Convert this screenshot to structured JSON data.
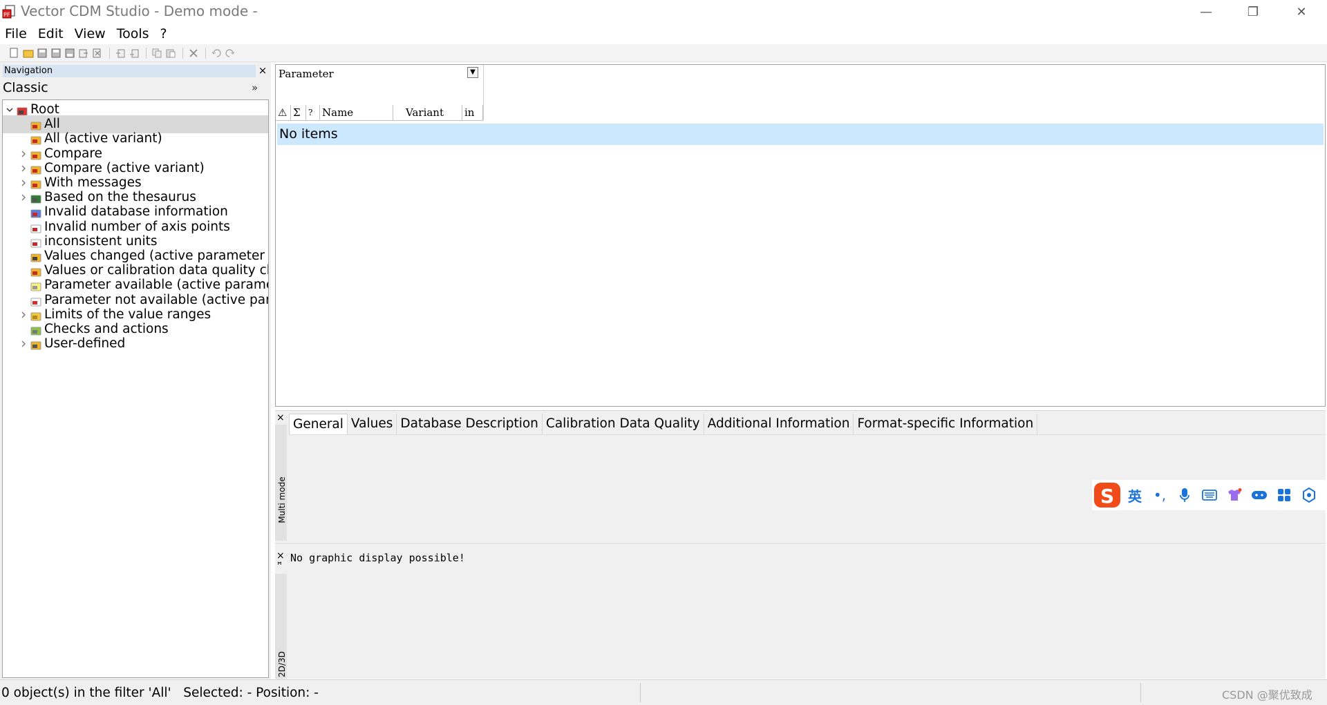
{
  "window": {
    "title": "Vector CDM Studio - Demo mode -",
    "controls": {
      "minimize": "—",
      "restore": "❐",
      "close": "✕"
    }
  },
  "menu": [
    "File",
    "Edit",
    "View",
    "Tools",
    "?"
  ],
  "toolbar": {
    "icons": [
      "new-file-icon",
      "open-folder-icon",
      "save-icon",
      "save-all-icon",
      "save-as-icon",
      "export-icon",
      "close-file-icon",
      "import-icon",
      "merge-icon",
      "copy-icon",
      "paste-icon",
      "delete-icon",
      "undo-icon",
      "redo-icon"
    ]
  },
  "navigation": {
    "header": "Navigation",
    "close": "×",
    "view_label": "Classic",
    "expand": "»",
    "tree": [
      {
        "label": "Root",
        "level": 0,
        "expander": "open",
        "icon": "root-icon",
        "selected": false
      },
      {
        "label": "All",
        "level": 1,
        "expander": "none",
        "icon": "filter-folder-icon",
        "selected": true
      },
      {
        "label": "All (active variant)",
        "level": 1,
        "expander": "none",
        "icon": "filter-folder-icon",
        "selected": false
      },
      {
        "label": "Compare",
        "level": 1,
        "expander": "closed",
        "icon": "compare-folder-icon",
        "selected": false
      },
      {
        "label": "Compare (active variant)",
        "level": 1,
        "expander": "closed",
        "icon": "compare-folder-icon",
        "selected": false
      },
      {
        "label": "With messages",
        "level": 1,
        "expander": "closed",
        "icon": "message-folder-icon",
        "selected": false
      },
      {
        "label": "Based on the thesaurus",
        "level": 1,
        "expander": "closed",
        "icon": "thesaurus-icon",
        "selected": false
      },
      {
        "label": "Invalid database information",
        "level": 1,
        "expander": "none",
        "icon": "database-warning-icon",
        "selected": false
      },
      {
        "label": "Invalid number of axis points",
        "level": 1,
        "expander": "none",
        "icon": "axis-warning-icon",
        "selected": false
      },
      {
        "label": "inconsistent units",
        "level": 1,
        "expander": "none",
        "icon": "units-icon",
        "selected": false
      },
      {
        "label": "Values changed (active parameter se",
        "level": 1,
        "expander": "none",
        "icon": "values-changed-icon",
        "selected": false
      },
      {
        "label": "Values or calibration data quality ch",
        "level": 1,
        "expander": "none",
        "icon": "quality-icon",
        "selected": false
      },
      {
        "label": "Parameter available (active paramet",
        "level": 1,
        "expander": "none",
        "icon": "parameter-available-icon",
        "selected": false
      },
      {
        "label": "Parameter not available (active para",
        "level": 1,
        "expander": "none",
        "icon": "parameter-missing-icon",
        "selected": false
      },
      {
        "label": "Limits of the value ranges",
        "level": 1,
        "expander": "closed",
        "icon": "folder-icon",
        "selected": false
      },
      {
        "label": "Checks and actions",
        "level": 1,
        "expander": "none",
        "icon": "checks-icon",
        "selected": false
      },
      {
        "label": "User-defined",
        "level": 1,
        "expander": "closed",
        "icon": "user-defined-icon",
        "selected": false
      }
    ]
  },
  "list": {
    "filter_label": "Parameter",
    "dropdown": "▼",
    "columns": [
      "⚠",
      "Σ",
      "?",
      "Name",
      "Variant",
      "in"
    ],
    "empty_text": "No items"
  },
  "details": {
    "close": "×",
    "strip_label": "Multi mode",
    "tabs": [
      "General",
      "Values",
      "Database Description",
      "Calibration Data Quality",
      "Additional Information",
      "Format-specific Information"
    ],
    "active_tab": 0
  },
  "ime": {
    "logo": "S",
    "items": [
      "英",
      "•,",
      "microphone-icon",
      "keyboard-icon",
      "skin-icon",
      "game-icon",
      "apps-icon",
      "settings-icon"
    ]
  },
  "graphic": {
    "close": "×",
    "pin": "ꟸ",
    "strip_label": "2D/3D",
    "message": "No graphic display possible!"
  },
  "status": {
    "text": "0 object(s) in the filter 'All'   Selected: - Position: -",
    "watermark": "CSDN @聚优致成"
  }
}
